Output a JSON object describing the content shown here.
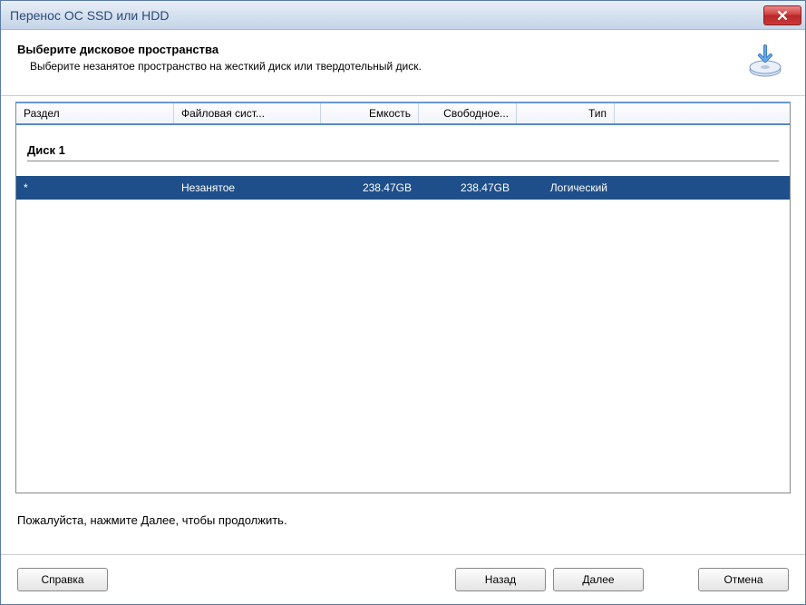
{
  "window": {
    "title": "Перенос ОС SSD или HDD"
  },
  "header": {
    "title": "Выберите дисковое пространства",
    "subtitle": "Выберите незанятое пространство на жесткий диск или твердотельный диск."
  },
  "table": {
    "columns": {
      "partition": "Раздел",
      "filesystem": "Файловая сист...",
      "capacity": "Емкость",
      "free": "Свободное...",
      "type": "Тип"
    },
    "disks": [
      {
        "name": "Диск 1",
        "rows": [
          {
            "partition": "*",
            "filesystem": "Незанятое",
            "capacity": "238.47GB",
            "free": "238.47GB",
            "type": "Логический",
            "selected": true
          }
        ]
      }
    ]
  },
  "hint": "Пожалуйста, нажмите Далее, чтобы продолжить.",
  "buttons": {
    "help": "Справка",
    "back": "Назад",
    "next": "Далее",
    "cancel": "Отмена"
  }
}
